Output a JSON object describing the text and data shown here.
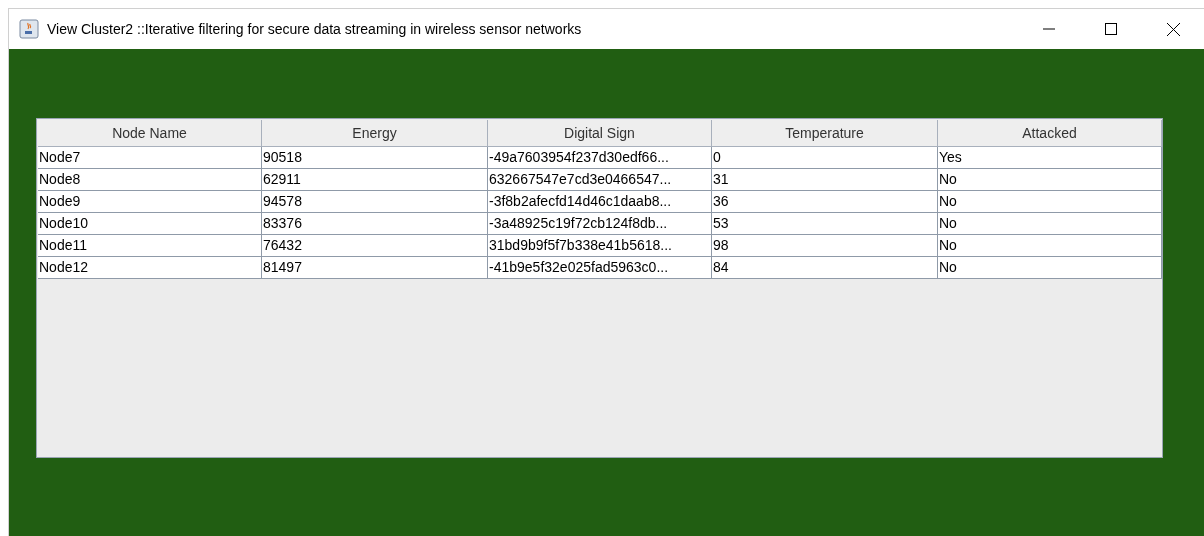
{
  "window": {
    "title": "View Cluster2 ::Iterative filtering for secure data streaming in wireless sensor networks"
  },
  "table": {
    "columns": [
      "Node Name",
      "Energy",
      "Digital Sign",
      "Temperature",
      "Attacked"
    ],
    "rows": [
      [
        "Node7",
        "90518",
        "-49a7603954f237d30edf66...",
        "0",
        "Yes"
      ],
      [
        "Node8",
        "62911",
        "632667547e7cd3e0466547...",
        "31",
        "No"
      ],
      [
        "Node9",
        "94578",
        "-3f8b2afecfd14d46c1daab8...",
        "36",
        "No"
      ],
      [
        "Node10",
        "83376",
        "-3a48925c19f72cb124f8db...",
        "53",
        "No"
      ],
      [
        "Node11",
        "76432",
        "31bd9b9f5f7b338e41b5618...",
        "98",
        "No"
      ],
      [
        "Node12",
        "81497",
        "-41b9e5f32e025fad5963c0...",
        "84",
        "No"
      ]
    ]
  }
}
